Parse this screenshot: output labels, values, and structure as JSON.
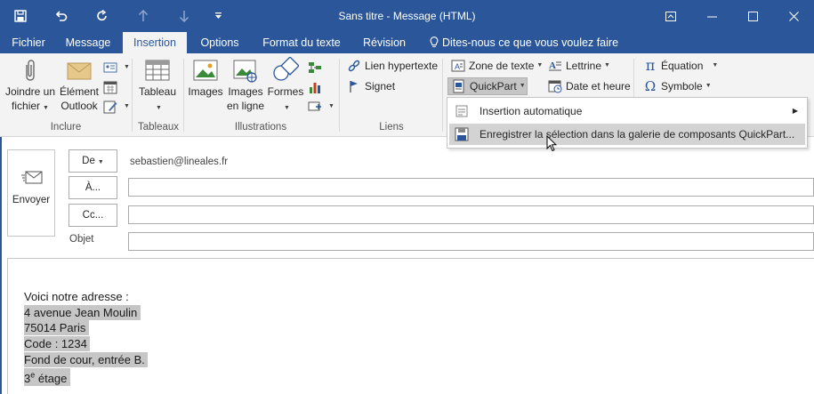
{
  "window": {
    "title": "Sans titre - Message (HTML)"
  },
  "colors": {
    "accent": "#2b579a",
    "ribbon_bg": "#f3f3f3",
    "selection": "#c6c6c6"
  },
  "tabs": [
    {
      "label": "Fichier"
    },
    {
      "label": "Message"
    },
    {
      "label": "Insertion",
      "active": true
    },
    {
      "label": "Options"
    },
    {
      "label": "Format du texte"
    },
    {
      "label": "Révision"
    }
  ],
  "tellme": "Dites-nous ce que vous voulez faire",
  "ribbon": {
    "groups": {
      "inclure": "Inclure",
      "tableaux": "Tableaux",
      "illustrations": "Illustrations",
      "liens": "Liens"
    },
    "joindre_l1": "Joindre un",
    "joindre_l2": "fichier",
    "element_l1": "Élément",
    "element_l2": "Outlook",
    "tableau": "Tableau",
    "images": "Images",
    "images_ligne_l1": "Images",
    "images_ligne_l2": "en ligne",
    "formes": "Formes",
    "lien_hypertexte": "Lien hypertexte",
    "signet": "Signet",
    "zone_texte": "Zone de texte",
    "quickpart": "QuickPart",
    "lettrine": "Lettrine",
    "date_heure": "Date et heure",
    "equation": "Équation",
    "symbole": "Symbole"
  },
  "menu": {
    "items": [
      {
        "label": "Insertion automatique",
        "has_submenu": true
      },
      {
        "label": "Enregistrer la sélection dans la galerie de composants QuickPart...",
        "highlighted": true
      }
    ]
  },
  "compose": {
    "send_label": "Envoyer",
    "from_label": "De",
    "from_value": "sebastien@lineales.fr",
    "to_label": "À...",
    "cc_label": "Cc...",
    "subject_label": "Objet",
    "to_value": "",
    "cc_value": "",
    "subject_value": ""
  },
  "body": {
    "lines": [
      {
        "text": "Voici notre adresse :",
        "selected": false
      },
      {
        "text": "4 avenue Jean Moulin ",
        "selected": true
      },
      {
        "text": "75014 Paris ",
        "selected": true
      },
      {
        "text": "Code : 1234 ",
        "selected": true
      },
      {
        "text": "Fond de cour, entrée B. ",
        "selected": true
      },
      {
        "text": "3e étage ",
        "selected": true
      }
    ]
  }
}
